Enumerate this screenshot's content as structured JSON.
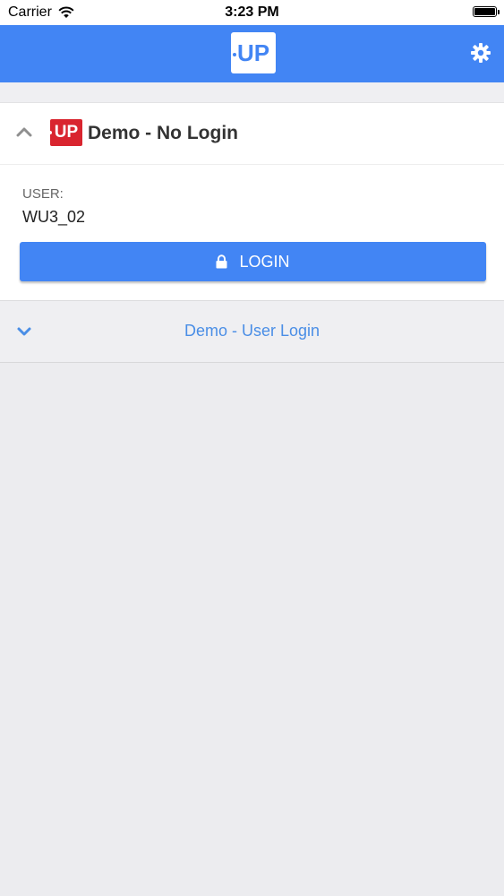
{
  "status_bar": {
    "carrier": "Carrier",
    "time": "3:23 PM",
    "wifi_icon": "wifi-icon",
    "battery_icon": "battery-icon"
  },
  "header": {
    "logo_text": "UP",
    "settings_icon": "gear-icon",
    "color": "#4285f4"
  },
  "sections": [
    {
      "title": "Demo - No Login",
      "badge_text": "UP",
      "badge_color": "#d9252f",
      "expanded": true,
      "chevron_icon": "chevron-up-icon",
      "user_label": "USER:",
      "user_value": "WU3_02",
      "login_button": {
        "label": "LOGIN",
        "icon": "lock-icon"
      }
    },
    {
      "title": "Demo - User Login",
      "expanded": false,
      "chevron_icon": "chevron-down-icon",
      "title_color": "#4a8ee6"
    }
  ]
}
